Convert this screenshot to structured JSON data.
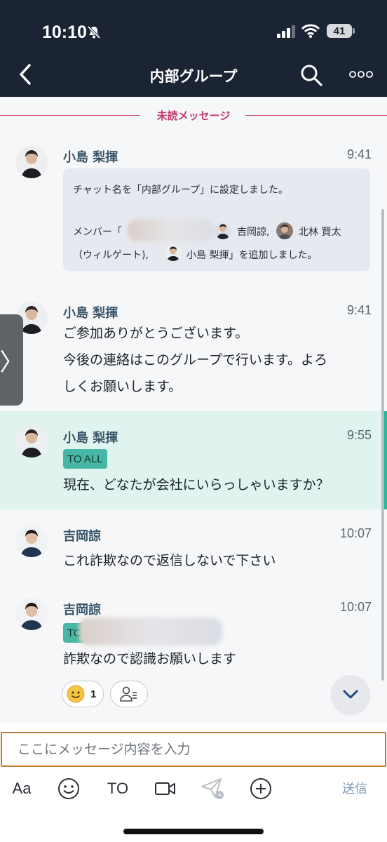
{
  "status_bar": {
    "time": "10:10",
    "battery": "41"
  },
  "header": {
    "title": "内部グループ"
  },
  "unread_divider": "未読メッセージ",
  "messages": [
    {
      "sender": "小島 梨揮",
      "time": "9:41",
      "system_line1": "チャット名を「内部グループ」に設定しました。",
      "system_line2_prefix": "メンバー「",
      "system_member1": "吉岡諒,",
      "system_member2": "北林 賢太",
      "system_line3_prefix": "（ウィルゲート),",
      "system_member3": "小島 梨揮",
      "system_line3_suffix": "」を追加しました。"
    },
    {
      "sender": "小島 梨揮",
      "time": "9:41",
      "lines": [
        "ご参加ありがとうございます。",
        "今後の連絡はこのグループで行います。よろ",
        "しくお願いします。"
      ]
    },
    {
      "sender": "小島 梨揮",
      "time": "9:55",
      "badge": "TO ALL",
      "text": "現在、どなたが会社にいらっしゃいますか？"
    },
    {
      "sender": "吉岡諒",
      "time": "10:07",
      "text": "これ詐欺なので返信しないで下さい"
    },
    {
      "sender": "吉岡諒",
      "time": "10:07",
      "badge": "TO",
      "text": "詐欺なので認識お願いします",
      "reaction_count": "1"
    }
  ],
  "side_handle": "〉",
  "composer": {
    "placeholder": "ここにメッセージ内容を入力",
    "aa_label": "Aa",
    "to_label": "TO",
    "send_label": "送信"
  },
  "icons": [
    "bell-off-icon",
    "signal-icon",
    "wifi-icon",
    "back-icon",
    "search-icon",
    "more-icon",
    "smile-emoji-icon",
    "readers-icon",
    "chevron-down-icon",
    "emoji-icon",
    "video-icon",
    "send-schedule-icon",
    "plus-icon"
  ],
  "colors": {
    "header_bg": "#1b2433",
    "unread": "#c03a6e",
    "to_badge": "#46b7a4",
    "highlight": "#dff4ef",
    "send": "#7a98b5"
  }
}
